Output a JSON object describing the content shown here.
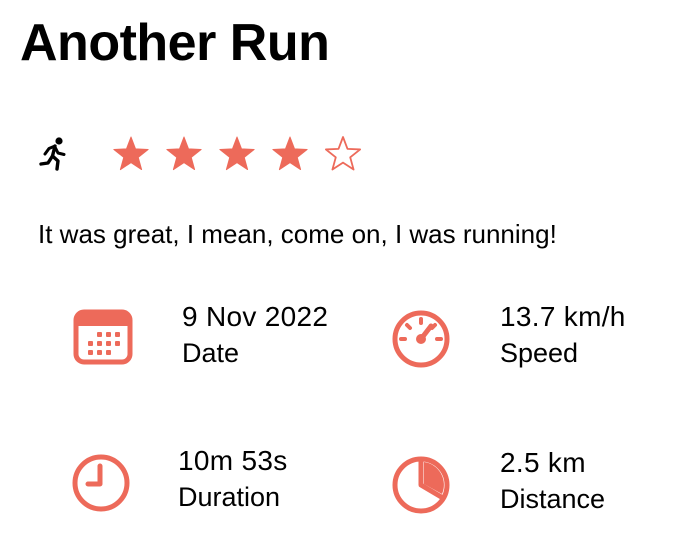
{
  "run": {
    "title": "Another Run",
    "activity_icon": "running-figure-icon",
    "rating": 4,
    "rating_max": 5,
    "notes": "It was great, I mean, come on, I was running!"
  },
  "stats": {
    "date": {
      "value": "9 Nov 2022",
      "label": "Date",
      "icon": "calendar-icon"
    },
    "speed": {
      "value": "13.7 km/h",
      "label": "Speed",
      "icon": "speedometer-icon"
    },
    "duration": {
      "value": "10m 53s",
      "label": "Duration",
      "icon": "clock-icon"
    },
    "distance": {
      "value": "2.5 km",
      "label": "Distance",
      "icon": "pie-chart-icon"
    }
  },
  "colors": {
    "accent": "#ED6A5A",
    "text": "#000000",
    "background": "#FFFFFF"
  }
}
